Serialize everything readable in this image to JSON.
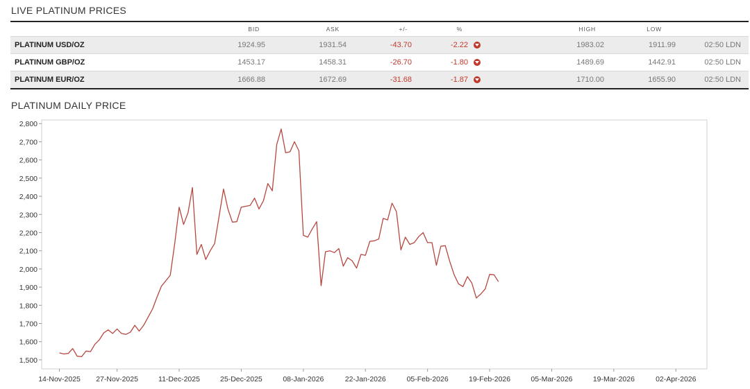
{
  "prices_section": {
    "title": "LIVE PLATINUM PRICES",
    "columns": [
      "BID",
      "ASK",
      "+/-",
      "%",
      "HIGH",
      "LOW"
    ],
    "rows": [
      {
        "name": "PLATINUM USD/OZ",
        "bid": "1924.95",
        "ask": "1931.54",
        "change": "-43.70",
        "pct": "-2.22",
        "high": "1983.02",
        "low": "1911.99",
        "time": "02:50 LDN",
        "direction": "down-icon"
      },
      {
        "name": "PLATINUM GBP/OZ",
        "bid": "1453.17",
        "ask": "1458.31",
        "change": "-26.70",
        "pct": "-1.80",
        "high": "1489.69",
        "low": "1442.91",
        "time": "02:50 LDN",
        "direction": "down-icon"
      },
      {
        "name": "PLATINUM EUR/OZ",
        "bid": "1666.88",
        "ask": "1672.69",
        "change": "-31.68",
        "pct": "-1.87",
        "high": "1710.00",
        "low": "1655.90",
        "time": "02:50 LDN",
        "direction": "down-icon"
      }
    ],
    "negative_color": "#c0392b"
  },
  "chart_section": {
    "title": "PLATINUM DAILY PRICE"
  },
  "chart_data": {
    "type": "line",
    "title": "",
    "xlabel": "",
    "ylabel": "",
    "ylim": [
      1450,
      2820
    ],
    "xlim": [
      "2025-11-10",
      "2026-04-09"
    ],
    "y_ticks": [
      "1,500",
      "1,600",
      "1,700",
      "1,800",
      "1,900",
      "2,000",
      "2,100",
      "2,200",
      "2,300",
      "2,400",
      "2,500",
      "2,600",
      "2,700",
      "2,800"
    ],
    "y_tick_values": [
      1500,
      1600,
      1700,
      1800,
      1900,
      2000,
      2100,
      2200,
      2300,
      2400,
      2500,
      2600,
      2700,
      2800
    ],
    "x_ticks": [
      {
        "date": "2025-11-14",
        "label": "14-Nov-2025"
      },
      {
        "date": "2025-11-27",
        "label": "27-Nov-2025"
      },
      {
        "date": "2025-12-11",
        "label": "11-Dec-2025"
      },
      {
        "date": "2025-12-25",
        "label": "25-Dec-2025"
      },
      {
        "date": "2026-01-08",
        "label": "08-Jan-2026"
      },
      {
        "date": "2026-01-22",
        "label": "22-Jan-2026"
      },
      {
        "date": "2026-02-05",
        "label": "05-Feb-2026"
      },
      {
        "date": "2026-02-19",
        "label": "19-Feb-2026"
      },
      {
        "date": "2026-03-05",
        "label": "05-Mar-2026"
      },
      {
        "date": "2026-03-19",
        "label": "19-Mar-2026"
      },
      {
        "date": "2026-04-02",
        "label": "02-Apr-2026"
      }
    ],
    "grid": false,
    "line_color": "#b5473f",
    "series": [
      {
        "values": [
          [
            "2025-11-14",
            1538
          ],
          [
            "2025-11-15",
            1532
          ],
          [
            "2025-11-16",
            1535
          ],
          [
            "2025-11-17",
            1562
          ],
          [
            "2025-11-18",
            1520
          ],
          [
            "2025-11-19",
            1517
          ],
          [
            "2025-11-20",
            1548
          ],
          [
            "2025-11-21",
            1545
          ],
          [
            "2025-11-22",
            1585
          ],
          [
            "2025-11-23",
            1610
          ],
          [
            "2025-11-24",
            1648
          ],
          [
            "2025-11-25",
            1665
          ],
          [
            "2025-11-26",
            1645
          ],
          [
            "2025-11-27",
            1670
          ],
          [
            "2025-11-28",
            1645
          ],
          [
            "2025-11-29",
            1640
          ],
          [
            "2025-11-30",
            1652
          ],
          [
            "2025-12-01",
            1690
          ],
          [
            "2025-12-02",
            1658
          ],
          [
            "2025-12-03",
            1690
          ],
          [
            "2025-12-04",
            1735
          ],
          [
            "2025-12-05",
            1780
          ],
          [
            "2025-12-06",
            1845
          ],
          [
            "2025-12-07",
            1905
          ],
          [
            "2025-12-08",
            1935
          ],
          [
            "2025-12-09",
            1965
          ],
          [
            "2025-12-10",
            2140
          ],
          [
            "2025-12-11",
            2340
          ],
          [
            "2025-12-12",
            2245
          ],
          [
            "2025-12-13",
            2310
          ],
          [
            "2025-12-14",
            2448
          ],
          [
            "2025-12-15",
            2080
          ],
          [
            "2025-12-16",
            2135
          ],
          [
            "2025-12-17",
            2052
          ],
          [
            "2025-12-18",
            2100
          ],
          [
            "2025-12-19",
            2140
          ],
          [
            "2025-12-20",
            2290
          ],
          [
            "2025-12-21",
            2440
          ],
          [
            "2025-12-22",
            2330
          ],
          [
            "2025-12-23",
            2258
          ],
          [
            "2025-12-24",
            2260
          ],
          [
            "2025-12-25",
            2340
          ],
          [
            "2025-12-26",
            2345
          ],
          [
            "2025-12-27",
            2350
          ],
          [
            "2025-12-28",
            2390
          ],
          [
            "2025-12-29",
            2330
          ],
          [
            "2025-12-30",
            2375
          ],
          [
            "2025-12-31",
            2470
          ],
          [
            "2026-01-01",
            2430
          ],
          [
            "2026-01-02",
            2685
          ],
          [
            "2026-01-03",
            2770
          ],
          [
            "2026-01-04",
            2640
          ],
          [
            "2026-01-05",
            2645
          ],
          [
            "2026-01-06",
            2700
          ],
          [
            "2026-01-07",
            2650
          ],
          [
            "2026-01-08",
            2185
          ],
          [
            "2026-01-09",
            2175
          ],
          [
            "2026-01-10",
            2220
          ],
          [
            "2026-01-11",
            2260
          ],
          [
            "2026-01-12",
            1908
          ],
          [
            "2026-01-13",
            2095
          ],
          [
            "2026-01-14",
            2100
          ],
          [
            "2026-01-15",
            2090
          ],
          [
            "2026-01-16",
            2112
          ],
          [
            "2026-01-17",
            2015
          ],
          [
            "2026-01-18",
            2062
          ],
          [
            "2026-01-19",
            2045
          ],
          [
            "2026-01-20",
            2005
          ],
          [
            "2026-01-21",
            2080
          ],
          [
            "2026-01-22",
            2075
          ],
          [
            "2026-01-23",
            2152
          ],
          [
            "2026-01-24",
            2155
          ],
          [
            "2026-01-25",
            2165
          ],
          [
            "2026-01-26",
            2278
          ],
          [
            "2026-01-27",
            2270
          ],
          [
            "2026-01-28",
            2362
          ],
          [
            "2026-01-29",
            2315
          ],
          [
            "2026-01-30",
            2105
          ],
          [
            "2026-01-31",
            2175
          ],
          [
            "2026-02-01",
            2135
          ],
          [
            "2026-02-02",
            2145
          ],
          [
            "2026-02-03",
            2178
          ],
          [
            "2026-02-04",
            2200
          ],
          [
            "2026-02-05",
            2145
          ],
          [
            "2026-02-06",
            2145
          ],
          [
            "2026-02-07",
            2020
          ],
          [
            "2026-02-08",
            2125
          ],
          [
            "2026-02-09",
            2128
          ],
          [
            "2026-02-10",
            2042
          ],
          [
            "2026-02-11",
            1968
          ],
          [
            "2026-02-12",
            1918
          ],
          [
            "2026-02-13",
            1903
          ],
          [
            "2026-02-14",
            1958
          ],
          [
            "2026-02-15",
            1922
          ],
          [
            "2026-02-16",
            1840
          ],
          [
            "2026-02-17",
            1862
          ],
          [
            "2026-02-18",
            1890
          ],
          [
            "2026-02-19",
            1970
          ],
          [
            "2026-02-20",
            1968
          ],
          [
            "2026-02-21",
            1930
          ]
        ]
      }
    ]
  }
}
